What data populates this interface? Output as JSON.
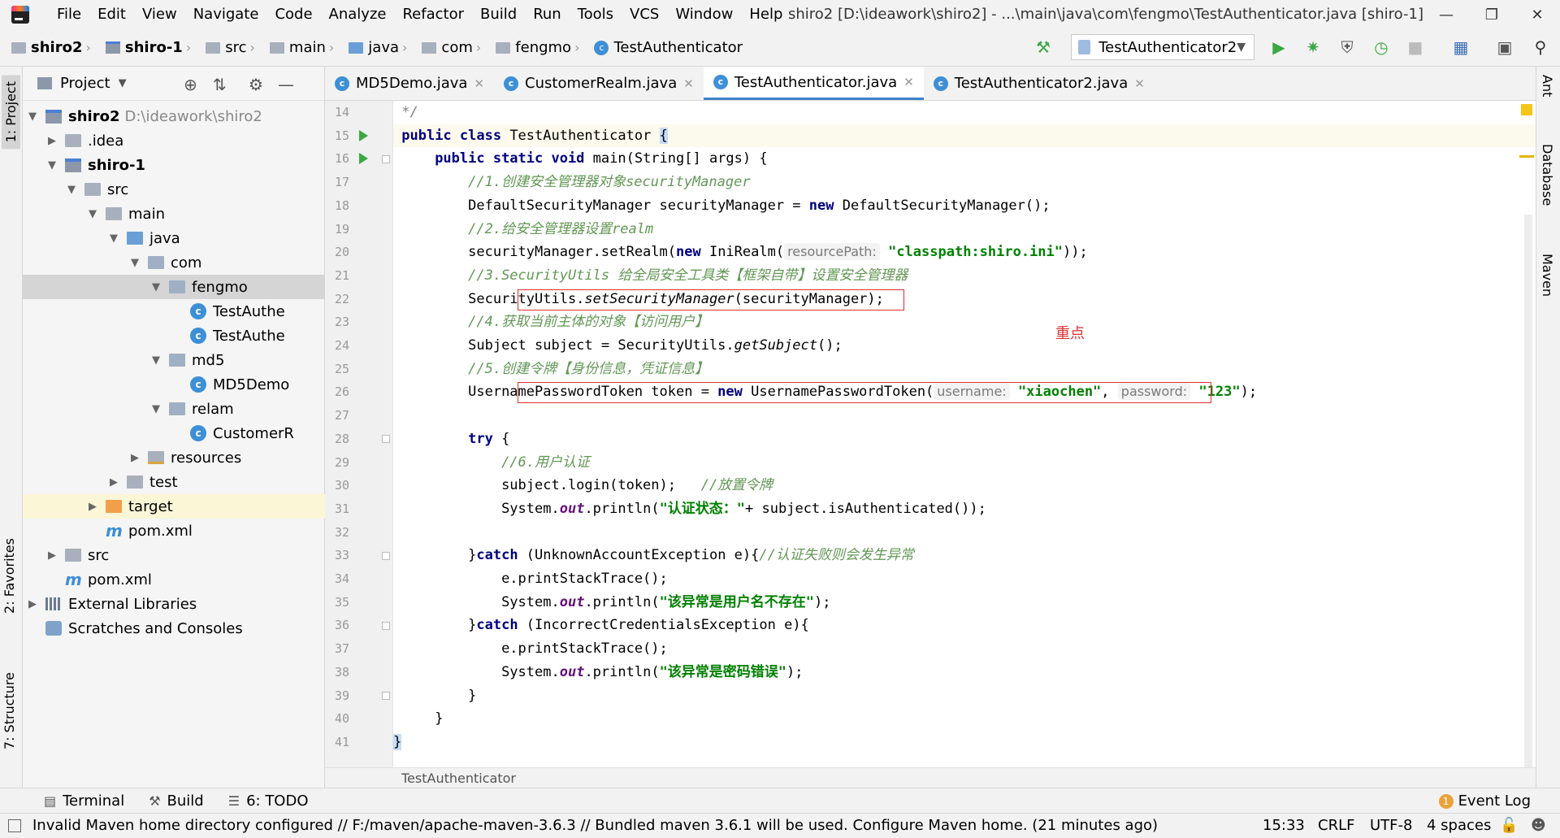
{
  "menu": [
    "File",
    "Edit",
    "View",
    "Navigate",
    "Code",
    "Analyze",
    "Refactor",
    "Build",
    "Run",
    "Tools",
    "VCS",
    "Window",
    "Help"
  ],
  "window_title": "shiro2 [D:\\ideawork\\shiro2] - ...\\main\\java\\com\\fengmo\\TestAuthenticator.java [shiro-1]",
  "nav_crumbs": [
    "shiro2",
    "shiro-1",
    "src",
    "main",
    "java",
    "com",
    "fengmo",
    "TestAuthenticator"
  ],
  "run_config": "TestAuthenticator2",
  "left_tabs": {
    "project": "1: Project",
    "favorites": "2: Favorites",
    "structure": "7: Structure"
  },
  "right_tabs": {
    "ant": "Ant",
    "database": "Database",
    "maven": "Maven"
  },
  "project_panel": {
    "title": "Project",
    "root_name": "shiro2",
    "root_path": "D:\\ideawork\\shiro2",
    "tree": [
      {
        "label": "shiro2"
      },
      {
        "label": ".idea"
      },
      {
        "label": "shiro-1"
      },
      {
        "label": "src"
      },
      {
        "label": "main"
      },
      {
        "label": "java"
      },
      {
        "label": "com"
      },
      {
        "label": "fengmo"
      },
      {
        "label": "TestAuthe"
      },
      {
        "label": "TestAuthe"
      },
      {
        "label": "md5"
      },
      {
        "label": "MD5Demo"
      },
      {
        "label": "relam"
      },
      {
        "label": "CustomerR"
      },
      {
        "label": "resources"
      },
      {
        "label": "test"
      },
      {
        "label": "target"
      },
      {
        "label": "pom.xml"
      },
      {
        "label": "src"
      },
      {
        "label": "pom.xml"
      },
      {
        "label": "External Libraries"
      },
      {
        "label": "Scratches and Consoles"
      }
    ]
  },
  "editor_tabs": [
    "MD5Demo.java",
    "CustomerRealm.java",
    "TestAuthenticator.java",
    "TestAuthenticator2.java"
  ],
  "code": {
    "line_numbers": [
      "14",
      "15",
      "16",
      "17",
      "18",
      "19",
      "20",
      "21",
      "22",
      "23",
      "24",
      "25",
      "26",
      "27",
      "28",
      "29",
      "30",
      "31",
      "32",
      "33",
      "34",
      "35",
      "36",
      "37",
      "38",
      "39",
      "40",
      "41"
    ],
    "l14": " */",
    "l15_kw": "public class ",
    "l15_name": "TestAuthenticator ",
    "l15_brace": "{",
    "l16_kw": "public static void ",
    "l16_rest": "main(String[] args) {",
    "l17": "//1.创建安全管理器对象securityManager",
    "l18_a": "DefaultSecurityManager securityManager = ",
    "l18_kw": "new ",
    "l18_b": "DefaultSecurityManager();",
    "l19": "//2.给安全管理器设置realm",
    "l20_a": "securityManager.setRealm(",
    "l20_kw": "new ",
    "l20_b": "IniRealm(",
    "l20_hint": "resourcePath:",
    "l20_str": "\"classpath:shiro.ini\"",
    "l20_c": "));",
    "l21": "//3.SecurityUtils 给全局安全工具类【框架自带】设置安全管理器",
    "l22_a": "SecurityUtils.",
    "l22_m": "setSecurityManager",
    "l22_b": "(securityManager);",
    "l23": "//4.获取当前主体的对象【访问用户】",
    "l24_a": "Subject subject = SecurityUtils.",
    "l24_m": "getSubject",
    "l24_b": "();",
    "l25": "//5.创建令牌【身份信息，凭证信息】",
    "l26_a": "UsernamePasswordToken token = ",
    "l26_kw": "new ",
    "l26_b": "UsernamePasswordToken(",
    "l26_hint1": "username:",
    "l26_str1": "\"xiaochen\"",
    "l26_sep": ", ",
    "l26_hint2": "password:",
    "l26_str2": "\"123\"",
    "l26_c": ");",
    "l28_kw": "try ",
    "l28_b": "{",
    "l29": "//6.用户认证",
    "l30_a": "subject.login(token);   ",
    "l30_cm": "//放置令牌",
    "l31_a": "System.",
    "l31_f": "out",
    "l31_b": ".println(",
    "l31_str": "\"认证状态：\"",
    "l31_c": "+ subject.isAuthenticated());",
    "l33_a": "}",
    "l33_kw": "catch ",
    "l33_b": "(UnknownAccountException e){",
    "l33_cm": "//认证失败则会发生异常",
    "l34": "e.printStackTrace();",
    "l35_a": "System.",
    "l35_f": "out",
    "l35_b": ".println(",
    "l35_str": "\"该异常是用户名不存在\"",
    "l35_c": ");",
    "l36_a": "}",
    "l36_kw": "catch ",
    "l36_b": "(IncorrectCredentialsException e){",
    "l37": "e.printStackTrace();",
    "l38_a": "System.",
    "l38_f": "out",
    "l38_b": ".println(",
    "l38_str": "\"该异常是密码错误\"",
    "l38_c": ");",
    "l39": "}",
    "l40": "}",
    "l41": "}"
  },
  "annotation_note": "重点",
  "editor_breadcrumb": "TestAuthenticator",
  "bottom_tabs": {
    "terminal": "Terminal",
    "build": "Build",
    "todo": "6: TODO"
  },
  "event_log": {
    "count": "1",
    "label": "Event Log"
  },
  "status": {
    "message": "Invalid Maven home directory configured // F:/maven/apache-maven-3.6.3 // Bundled maven 3.6.1 will be used.  Configure Maven home. (21 minutes ago)",
    "position": "15:33",
    "line_sep": "CRLF",
    "encoding": "UTF-8",
    "indent": "4 spaces"
  },
  "colors": {
    "keyword": "#000080",
    "string": "#008000",
    "comment": "#629755",
    "annotation": "#e03030"
  }
}
